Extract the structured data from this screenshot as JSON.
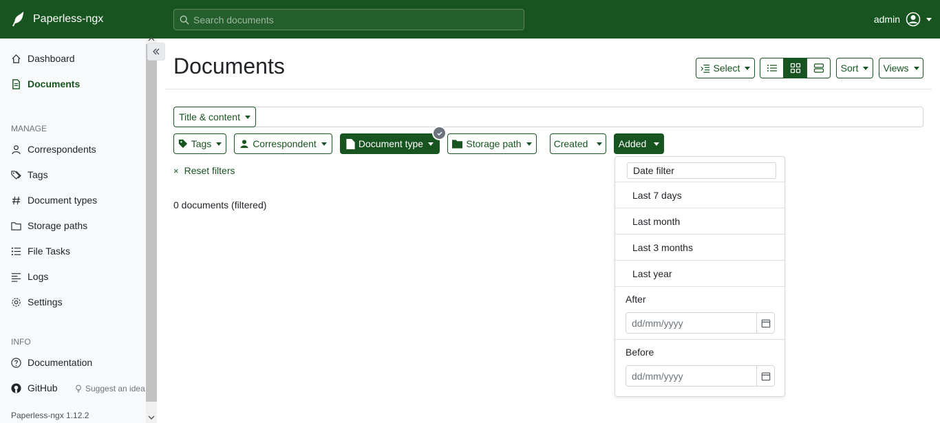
{
  "app": {
    "brand": "Paperless-ngx",
    "version": "Paperless-ngx 1.12.2"
  },
  "search": {
    "placeholder": "Search documents"
  },
  "user": {
    "name": "admin"
  },
  "sidebar": {
    "items": [
      {
        "label": "Dashboard",
        "icon": "house-icon"
      },
      {
        "label": "Documents",
        "icon": "file-icon",
        "active": true
      }
    ],
    "manage_heading": "MANAGE",
    "manage": [
      {
        "label": "Correspondents",
        "icon": "person-icon"
      },
      {
        "label": "Tags",
        "icon": "tags-icon"
      },
      {
        "label": "Document types",
        "icon": "hash-icon"
      },
      {
        "label": "Storage paths",
        "icon": "folder-icon"
      },
      {
        "label": "File Tasks",
        "icon": "list-task-icon"
      },
      {
        "label": "Logs",
        "icon": "text-left-icon"
      },
      {
        "label": "Settings",
        "icon": "gear-icon"
      }
    ],
    "info_heading": "INFO",
    "info": [
      {
        "label": "Documentation",
        "icon": "question-circle-icon"
      },
      {
        "label": "GitHub",
        "icon": "github-icon"
      }
    ],
    "suggest": "Suggest an idea"
  },
  "main": {
    "title": "Documents",
    "toolbar": {
      "select": "Select",
      "sort": "Sort",
      "views": "Views"
    },
    "text_filter_type": "Title & content",
    "filters": {
      "tags": "Tags",
      "correspondent": "Correspondent",
      "document_type": "Document type",
      "storage_path": "Storage path",
      "created": "Created",
      "added": "Added"
    },
    "reset": "Reset filters",
    "count": "0 documents (filtered)"
  },
  "date_dropdown": {
    "title": "Date filter",
    "options": [
      "Last 7 days",
      "Last month",
      "Last 3 months",
      "Last year"
    ],
    "after_label": "After",
    "before_label": "Before",
    "date_placeholder": "dd/mm/yyyy"
  },
  "colors": {
    "primary": "#17541f",
    "sidebar_bg": "#f8f9fa"
  }
}
